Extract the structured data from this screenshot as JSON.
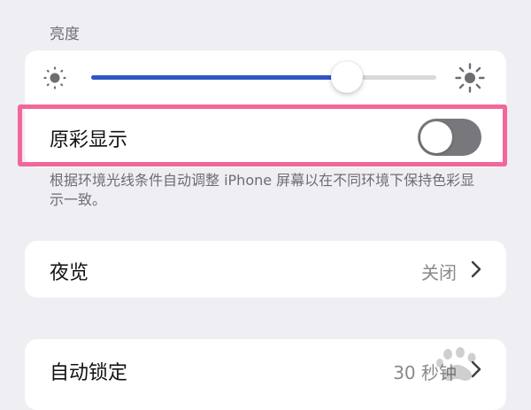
{
  "brightness": {
    "section_label": "亮度",
    "level": 0.74,
    "fill_color": "#2f56c8",
    "icon_low": "sun-small-icon",
    "icon_high": "sun-large-icon"
  },
  "true_tone": {
    "label": "原彩显示",
    "enabled": false,
    "highlight_color": "#f2679a",
    "footnote": "根据环境光线条件自动调整 iPhone 屏幕以在不同环境下保持色彩显示一致。"
  },
  "night_shift": {
    "label": "夜览",
    "value": "关闭",
    "icon": "chevron-right-icon"
  },
  "auto_lock": {
    "label": "自动锁定",
    "value": "30 秒钟",
    "icon": "chevron-right-icon"
  },
  "colors": {
    "background": "#efeef3",
    "card": "#ffffff",
    "toggle_off": "#78787c",
    "secondary_text": "#8a8a8e"
  }
}
